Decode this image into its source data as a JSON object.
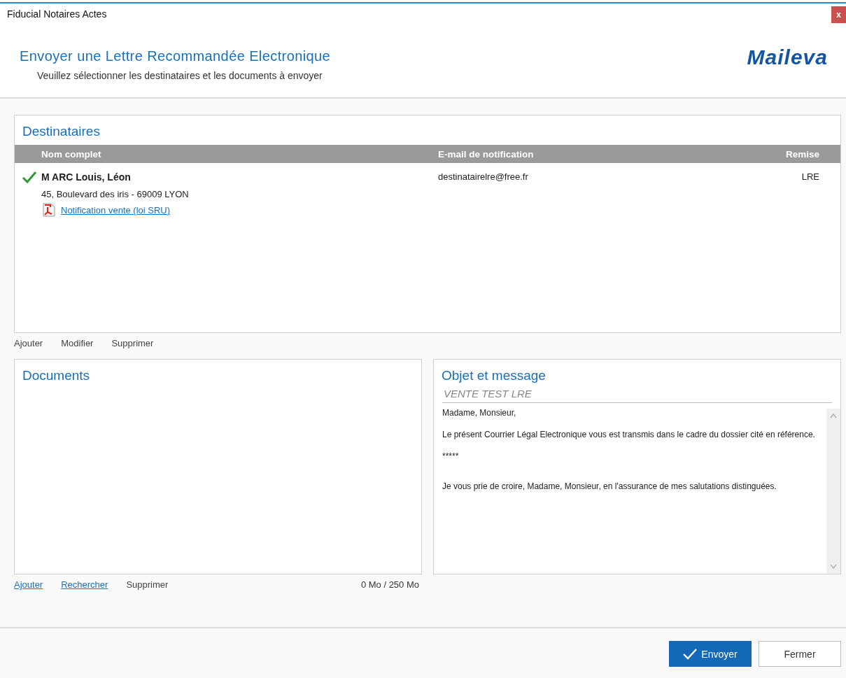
{
  "window": {
    "title": "Fiducial Notaires Actes",
    "close": "x"
  },
  "header": {
    "title": "Envoyer une Lettre Recommandée Electronique",
    "subtitle": "Veuillez sélectionner les destinataires et les documents à envoyer",
    "logo": "Maileva"
  },
  "recipients": {
    "title": "Destinataires",
    "columns": [
      "Nom complet",
      "E-mail de notification",
      "Remise"
    ],
    "rows": [
      {
        "valid": true,
        "name": "M ARC Louis, Léon",
        "address": "45, Boulevard des iris  - 69009 LYON",
        "document": "Notification vente (loi SRU)",
        "email": "destinatairelre@free.fr",
        "delivery": "LRE"
      }
    ],
    "actions": [
      {
        "label": "Ajouter",
        "enabled": false
      },
      {
        "label": "Modifier",
        "enabled": false
      },
      {
        "label": "Supprimer",
        "enabled": false
      }
    ]
  },
  "documents": {
    "title": "Documents",
    "actions": [
      {
        "label": "Ajouter",
        "enabled": true
      },
      {
        "label": "Rechercher",
        "enabled": true
      },
      {
        "label": "Supprimer",
        "enabled": false
      }
    ],
    "size": "0 Mo / 250 Mo"
  },
  "message": {
    "title": "Objet et message",
    "subject": "VENTE TEST LRE",
    "paragraphs": [
      "Madame, Monsieur,",
      "Le présent Courrier Légal Electronique vous est transmis dans le cadre du dossier cité en référence.",
      "*****",
      "Je vous prie de croire, Madame, Monsieur, en l'assurance de mes salutations distinguées."
    ]
  },
  "buttons": [
    {
      "label": "Envoyer",
      "kind": "primary"
    },
    {
      "label": "Fermer",
      "kind": "secondary"
    }
  ]
}
